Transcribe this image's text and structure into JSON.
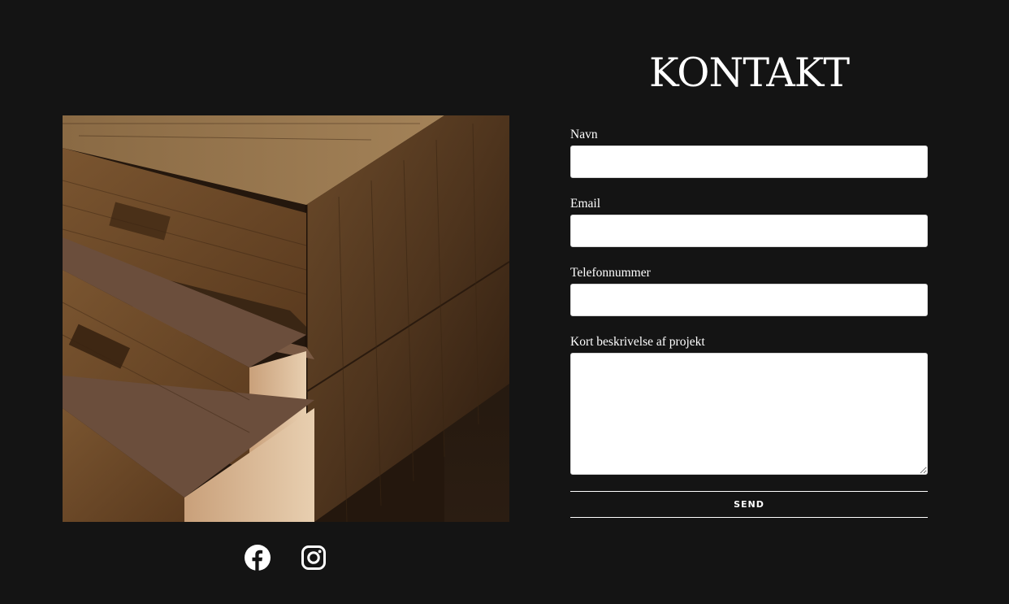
{
  "contact": {
    "title": "KONTAKT",
    "fields": {
      "name": {
        "label": "Navn",
        "value": ""
      },
      "email": {
        "label": "Email",
        "value": ""
      },
      "phone": {
        "label": "Telefonnummer",
        "value": ""
      },
      "description": {
        "label": "Kort beskrivelse af projekt",
        "value": ""
      }
    },
    "submit_label": "SEND"
  },
  "social": [
    {
      "icon": "facebook-icon"
    },
    {
      "icon": "instagram-icon"
    }
  ],
  "colors": {
    "background": "#141414",
    "text": "#ffffff",
    "input_background": "#ffffff"
  }
}
